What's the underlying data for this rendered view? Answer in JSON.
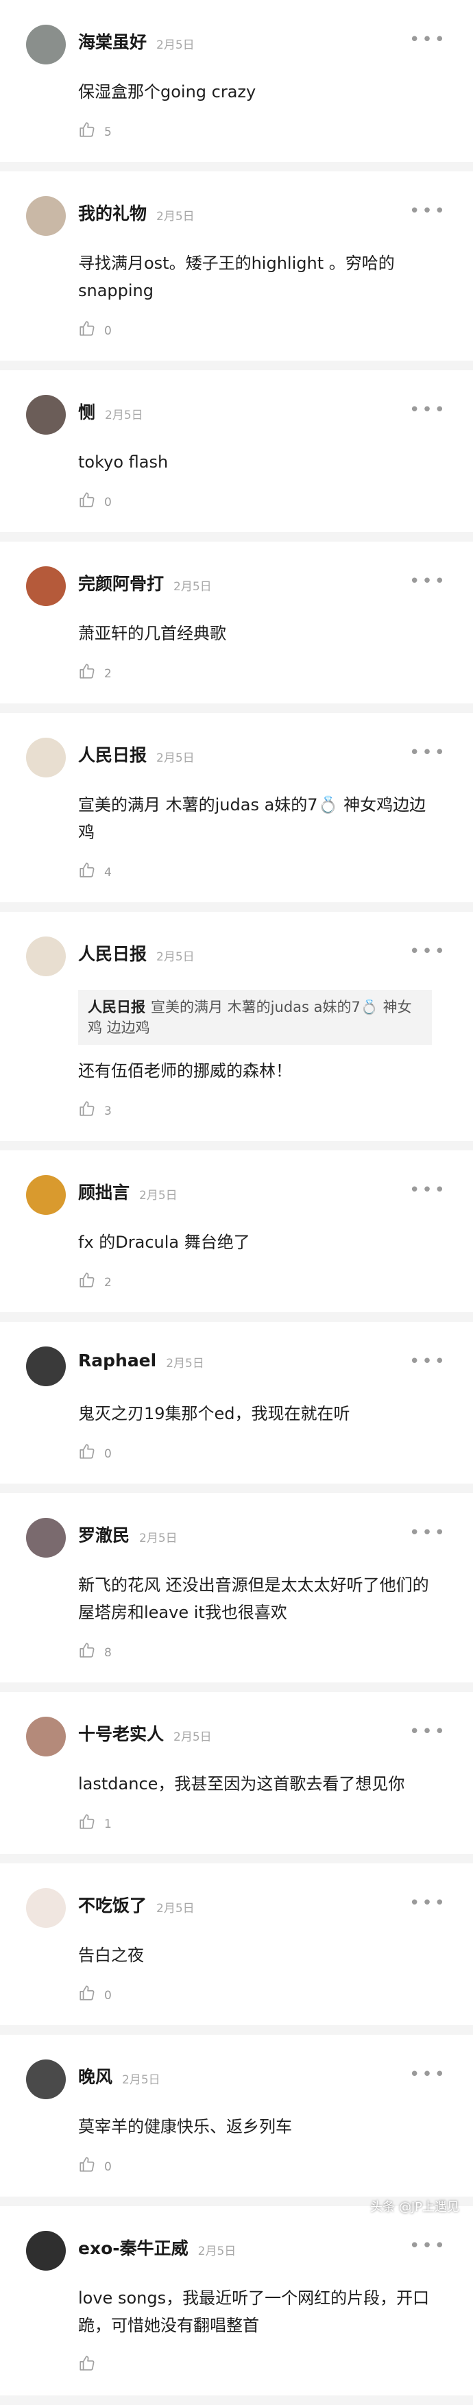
{
  "comments": [
    {
      "name": "海棠虽好",
      "date": "2月5日",
      "text": "保湿盒那个going crazy",
      "likes": "5",
      "avatar_color": "#8a8f8c"
    },
    {
      "name": "我的礼物",
      "date": "2月5日",
      "text": "寻找满月ost。矮子王的highlight 。穷哈的snapping",
      "likes": "0",
      "avatar_color": "#c9b8a6"
    },
    {
      "name": "恻",
      "date": "2月5日",
      "text": "tokyo flash",
      "likes": "0",
      "avatar_color": "#6b5d58"
    },
    {
      "name": "完颜阿骨打",
      "date": "2月5日",
      "text": "萧亚轩的几首经典歌",
      "likes": "2",
      "avatar_color": "#b55a3a"
    },
    {
      "name": "人民日报",
      "date": "2月5日",
      "text": "宣美的满月 木薯的judas a妹的7💍 神女鸡边边鸡",
      "likes": "4",
      "avatar_color": "#e8ded0"
    },
    {
      "name": "人民日报",
      "date": "2月5日",
      "quote_name": "人民日报",
      "quote_text": "宣美的满月 木薯的judas a妹的7💍 神女鸡 边边鸡",
      "text": "还有伍佰老师的挪威的森林！",
      "likes": "3",
      "avatar_color": "#e8ded0"
    },
    {
      "name": "顾拙言",
      "date": "2月5日",
      "text": "fx 的Dracula 舞台绝了",
      "likes": "2",
      "avatar_color": "#d99a2e"
    },
    {
      "name": "Raphael",
      "date": "2月5日",
      "text": "鬼灭之刃19集那个ed，我现在就在听",
      "likes": "0",
      "avatar_color": "#3a3a3a"
    },
    {
      "name": "罗澈民",
      "date": "2月5日",
      "text": "新飞的花风 还没出音源但是太太太好听了他们的屋塔房和leave it我也很喜欢",
      "likes": "8",
      "avatar_color": "#7a6a6e"
    },
    {
      "name": "十号老实人",
      "date": "2月5日",
      "text": "lastdance，我甚至因为这首歌去看了想见你",
      "likes": "1",
      "avatar_color": "#b48a7a"
    },
    {
      "name": "不吃饭了",
      "date": "2月5日",
      "text": "告白之夜",
      "likes": "0",
      "avatar_color": "#f0e6e0"
    },
    {
      "name": "晚风",
      "date": "2月5日",
      "text": "莫宰羊的健康快乐、返乡列车",
      "likes": "0",
      "avatar_color": "#4a4a4a"
    },
    {
      "name": "exo-秦牛正威",
      "date": "2月5日",
      "text": "love songs，我最近听了一个网红的片段，开口跪，可惜她没有翻唱整首",
      "likes": "",
      "avatar_color": "#2f2f2f"
    }
  ],
  "watermark": "头条 @JP上遇见"
}
